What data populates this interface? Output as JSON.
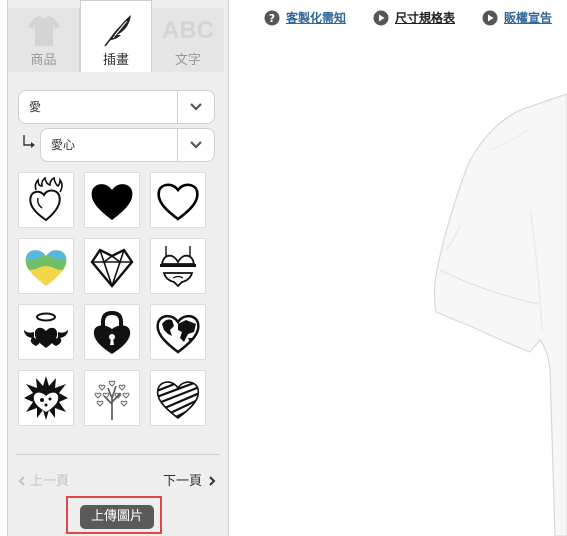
{
  "tabs": [
    {
      "label": "商品",
      "icon": "tshirt-icon"
    },
    {
      "label": "插畫",
      "icon": "feather-icon"
    },
    {
      "label": "文字",
      "icon": "abc-icon",
      "icon_text": "ABC"
    }
  ],
  "active_tab": "插畫",
  "filters": {
    "category": "愛",
    "subcategory": "愛心"
  },
  "clipart": [
    {
      "name": "flaming-heart-icon"
    },
    {
      "name": "solid-heart-icon"
    },
    {
      "name": "outline-heart-icon"
    },
    {
      "name": "wavy-colored-heart-icon"
    },
    {
      "name": "gem-heart-icon"
    },
    {
      "name": "lingerie-icon"
    },
    {
      "name": "angel-hearts-icon"
    },
    {
      "name": "heart-padlock-icon"
    },
    {
      "name": "world-map-heart-icon"
    },
    {
      "name": "burst-heart-icon"
    },
    {
      "name": "heart-tree-icon"
    },
    {
      "name": "scribble-heart-icon"
    }
  ],
  "pager": {
    "prev": "上一頁",
    "next": "下一頁"
  },
  "upload_label": "上傳圖片",
  "top_links": [
    {
      "label": "客製化需知",
      "icon": "question-icon"
    },
    {
      "label": "尺寸規格表",
      "icon": "play-icon"
    },
    {
      "label": "販權宣告",
      "icon": "play-icon"
    }
  ],
  "colors": {
    "accent": "#336699",
    "highlight_border": "#e04848",
    "upload_button": "#5a5a5a"
  }
}
